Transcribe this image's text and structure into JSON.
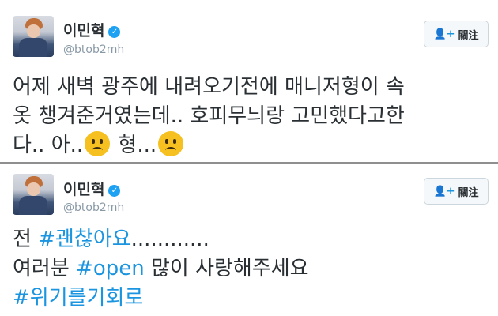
{
  "tweets": [
    {
      "display_name": "이민혁",
      "handle": "@btob2mh",
      "follow_label": "關注",
      "lines": [
        "어제 새벽 광주에 내려오기전에 매니저형이 속",
        "옷 챙겨준거였는데.. 호피무늬랑 고민했다고한",
        "다.. 아.."
      ],
      "line3_mid": " 형...",
      "emoji": "frowning-face"
    },
    {
      "display_name": "이민혁",
      "handle": "@btob2mh",
      "follow_label": "關注",
      "l1_pre": "전 ",
      "l1_tag": "#괜찮아요",
      "l1_post": "............",
      "l2_pre": "여러분 ",
      "l2_tag": "#open",
      "l2_post": " 많이 사랑해주세요",
      "l3_tag": "#위기를기회로"
    }
  ],
  "colors": {
    "hashtag": "#1b95e0",
    "verified": "#1da1f2",
    "handle": "#8899a6"
  },
  "icons": {
    "verified": "verified-badge-icon",
    "follow": "add-user-icon"
  }
}
